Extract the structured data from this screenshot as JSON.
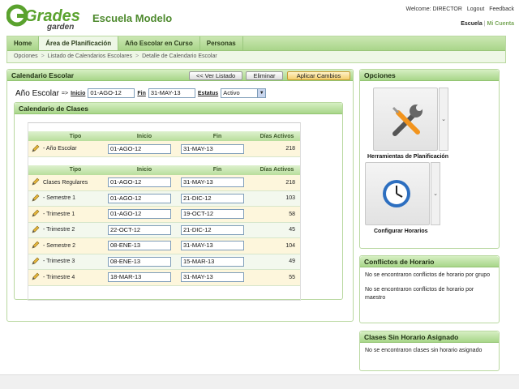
{
  "header": {
    "logo_main": "Grades",
    "logo_sub": "garden",
    "school_name": "Escuela Modelo",
    "welcome": "Welcome: DIRECTOR",
    "logout": "Logout",
    "feedback": "Feedback",
    "school_selector": "Escuela",
    "my_account": "Mi Cuenta"
  },
  "nav": {
    "tabs": [
      {
        "label": "Home"
      },
      {
        "label": "Área de Planificación"
      },
      {
        "label": "Año Escolar en Curso"
      },
      {
        "label": "Personas"
      }
    ],
    "breadcrumb": [
      "Opciones",
      "Listado de Calendarios Escolares",
      "Detalle de Calendario Escolar"
    ]
  },
  "calendar": {
    "title": "Calendario Escolar",
    "btn_list": "<< Ver Listado",
    "btn_delete": "Eliminar",
    "btn_apply": "Aplicar Cambios",
    "year_label": "Año Escolar",
    "year_arrow": "=>",
    "start_label": "Inicio",
    "start_value": "01-AGO-12",
    "end_label": "Fin",
    "end_value": "31-MAY-13",
    "status_label": "Estatus",
    "status_value": "Activo"
  },
  "classes": {
    "title": "Calendario de Clases",
    "headers": {
      "type": "Tipo",
      "start": "Inicio",
      "end": "Fin",
      "days": "Días Activos"
    },
    "year_row": {
      "type": "- Año Escolar",
      "start": "01-AGO-12",
      "end": "31-MAY-13",
      "days": "218"
    },
    "rows": [
      {
        "type": "Clases Regulares",
        "start": "01-AGO-12",
        "end": "31-MAY-13",
        "days": "218"
      },
      {
        "type": "- Semestre 1",
        "start": "01-AGO-12",
        "end": "21-DIC-12",
        "days": "103"
      },
      {
        "type": "- Trimestre 1",
        "start": "01-AGO-12",
        "end": "19-OCT-12",
        "days": "58"
      },
      {
        "type": "- Trimestre 2",
        "start": "22-OCT-12",
        "end": "21-DIC-12",
        "days": "45"
      },
      {
        "type": "- Semestre 2",
        "start": "08-ENE-13",
        "end": "31-MAY-13",
        "days": "104"
      },
      {
        "type": "- Trimestre 3",
        "start": "08-ENE-13",
        "end": "15-MAR-13",
        "days": "49"
      },
      {
        "type": "- Trimestre 4",
        "start": "18-MAR-13",
        "end": "31-MAY-13",
        "days": "55"
      }
    ]
  },
  "options": {
    "title": "Opciones",
    "tool1": "Herramientas de Planificación",
    "tool2": "Configurar Horarios"
  },
  "conflicts": {
    "title": "Conflictos de Horario",
    "msg1": "No se encontraron conflictos de horario por grupo",
    "msg2": "No se encontraron conflictos de horario por maestro"
  },
  "unassigned": {
    "title": "Clases Sin Horario Asignado",
    "msg": "No se encontraron clases sin horario asignado"
  },
  "colors": {
    "accent_green": "#a8d68a",
    "brand_green": "#4e8a2e",
    "apply_button": "#f4cf6d"
  }
}
